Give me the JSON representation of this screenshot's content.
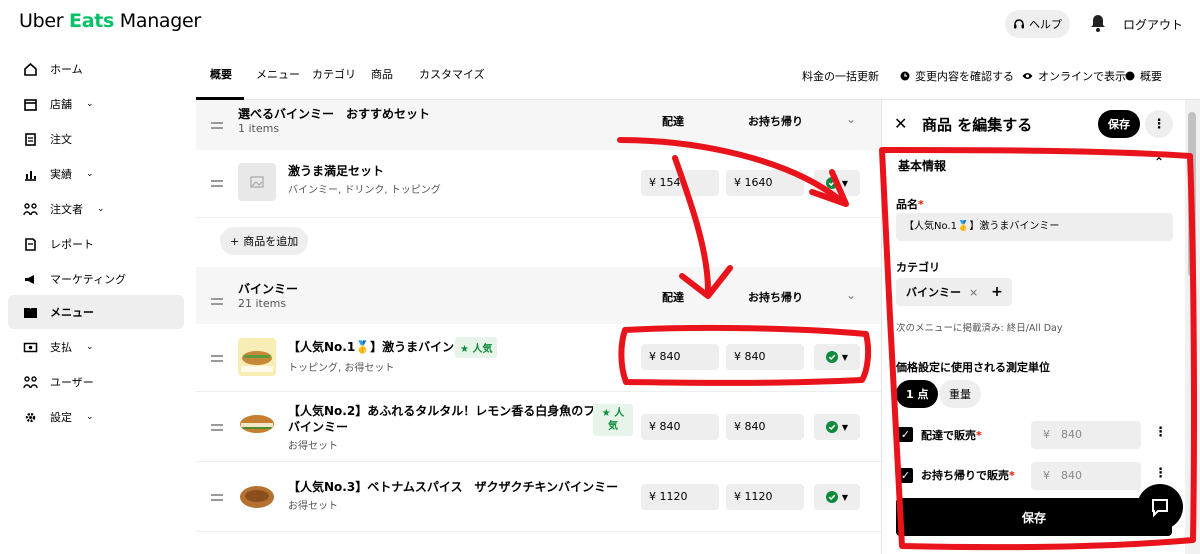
{
  "header": {
    "logo_prefix": "Uber ",
    "logo_eats": "Eats",
    "logo_suffix": " Manager",
    "help_label": "ヘルプ",
    "logout_label": "ログアウト"
  },
  "sidebar": {
    "items": [
      {
        "label": "ホーム",
        "icon": "home-icon"
      },
      {
        "label": "店舗",
        "icon": "store-icon",
        "chevron": "⌄"
      },
      {
        "label": "注文",
        "icon": "receipt-icon"
      },
      {
        "label": "実績",
        "icon": "chart-icon",
        "chevron": "⌄"
      },
      {
        "label": "注文者",
        "icon": "people-icon",
        "chevron": "⌄"
      },
      {
        "label": "レポート",
        "icon": "report-icon"
      },
      {
        "label": "マーケティング",
        "icon": "megaphone-icon"
      },
      {
        "label": "メニュー",
        "icon": "book-icon"
      },
      {
        "label": "支払",
        "icon": "money-icon",
        "chevron": "⌄"
      },
      {
        "label": "ユーザー",
        "icon": "users-icon"
      },
      {
        "label": "設定",
        "icon": "gear-icon",
        "chevron": "⌄"
      }
    ]
  },
  "tabs": [
    "概要",
    "メニュー",
    "カテゴリ",
    "商品",
    "カスタマイズ"
  ],
  "top_actions": {
    "bulk_price": "料金の一括更新",
    "review": "変更内容を確認する",
    "online_view": "オンラインで表示",
    "overview": "概要"
  },
  "columns": {
    "delivery": "配達",
    "takeout": "お持ち帰り"
  },
  "categories": [
    {
      "title": "選べるバインミー　おすすめセット",
      "count": "1 items",
      "items": [
        {
          "name": "激うま満足セット",
          "sub": "バインミー, ドリンク, トッピング",
          "delivery": "¥ 154",
          "takeout": "¥ 1640"
        }
      ],
      "add_label": "商品を追加"
    },
    {
      "title": "バインミー",
      "count": "21 items",
      "items": [
        {
          "name": "【人気No.1🥇】激うまバインミー",
          "sub": "トッピング, お得セット",
          "delivery": "¥ 840",
          "takeout": "¥ 840",
          "badge": "★ 人気"
        },
        {
          "name": "【人気No.2】あふれるタルタル！レモン香る白身魚のフライ",
          "name2": "バインミー",
          "sub": "お得セット",
          "delivery": "¥ 840",
          "takeout": "¥ 840",
          "badge_l1": "★ 人",
          "badge_l2": "気"
        },
        {
          "name": "【人気No.3】ベトナムスパイス　ザクザクチキンバインミー",
          "sub": "お得セット",
          "delivery": "¥ 1120",
          "takeout": "¥ 1120"
        }
      ]
    }
  ],
  "panel": {
    "title": "商品 を編集する",
    "save_label": "保存",
    "section": "基本情報",
    "name_label": "品名",
    "name_value": "【人気No.1🥇】激うまバインミー",
    "category_label": "カテゴリ",
    "category_chip": "バインミー",
    "menu_note": "次のメニューに掲載済み: 終日/All Day",
    "unit_label": "価格設定に使用される測定単位",
    "unit_on": "1 点",
    "unit_off": "重量",
    "delivery_label": "配達で販売",
    "delivery_price": "¥　840",
    "takeout_label": "お持ち帰りで販売",
    "takeout_price": "¥　840",
    "big_save": "保存"
  },
  "colors": {
    "accent": "#06c167",
    "annotation": "#e8131b",
    "badge_green": "#0e8a3c"
  }
}
